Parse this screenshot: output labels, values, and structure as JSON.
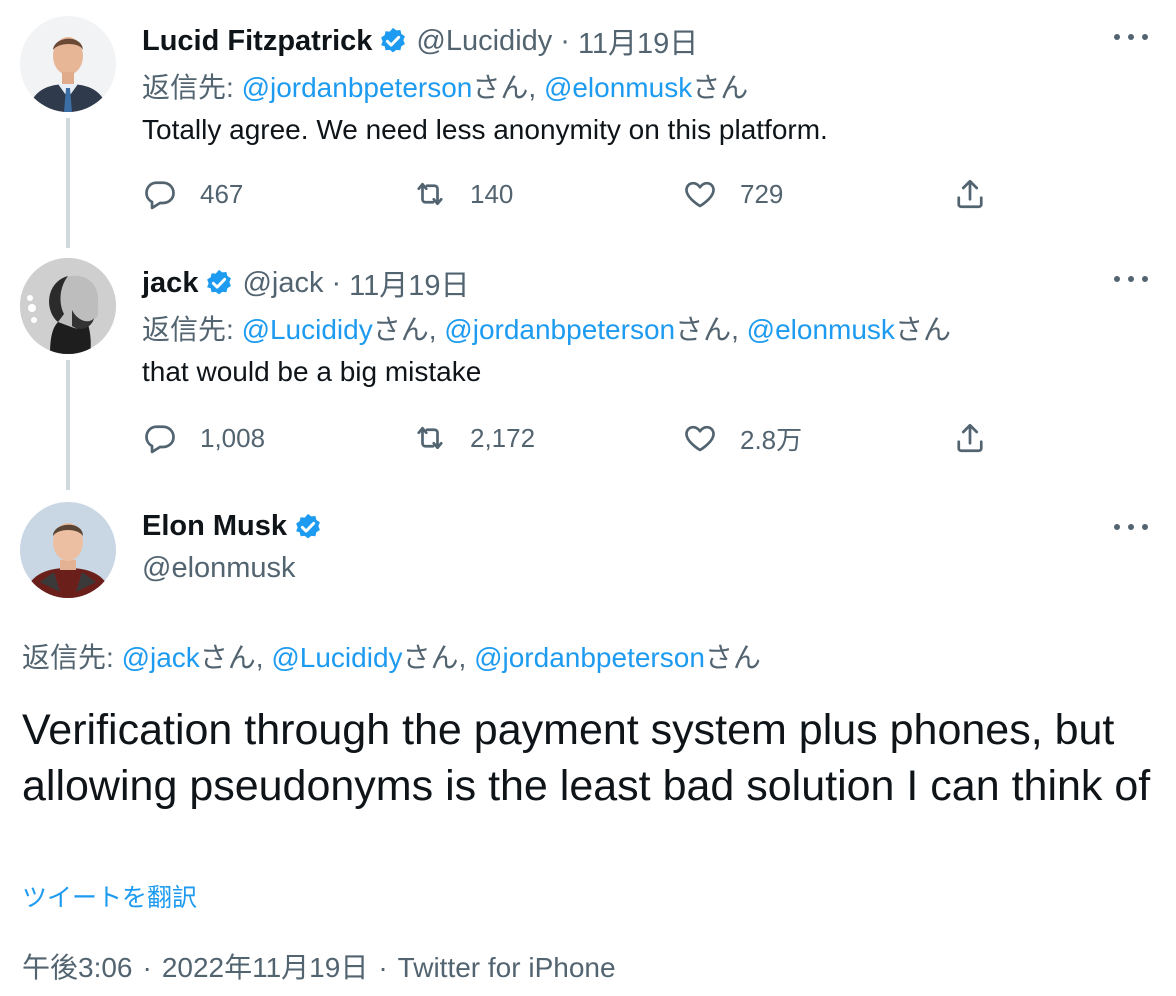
{
  "tweets": [
    {
      "name": "Lucid Fitzpatrick",
      "handle": "@Lucididy",
      "date": "11月19日",
      "reply_label": "返信先: ",
      "mentions": [
        "@jordanbpeterson",
        "@elonmusk"
      ],
      "mention_suffix": "さん",
      "mention_sep": ", ",
      "text": "Totally agree. We need less anonymity on this platform.",
      "replies": "467",
      "retweets": "140",
      "likes": "729"
    },
    {
      "name": "jack",
      "handle": "@jack",
      "date": "11月19日",
      "reply_label": "返信先: ",
      "mentions": [
        "@Lucididy",
        "@jordanbpeterson",
        "@elonmusk"
      ],
      "mention_suffix": "さん",
      "mention_sep": ", ",
      "text": "that would be a big mistake",
      "replies": "1,008",
      "retweets": "2,172",
      "likes": "2.8万"
    }
  ],
  "main": {
    "name": "Elon Musk",
    "handle": "@elonmusk",
    "reply_label": "返信先: ",
    "mentions": [
      "@jack",
      "@Lucididy",
      "@jordanbpeterson"
    ],
    "mention_suffix": "さん",
    "mention_sep": ", ",
    "text": "Verification through the payment system plus phones, but allowing pseudonyms is the least bad solution I can think of",
    "translate": "ツイートを翻訳",
    "time": "午後3:06",
    "date": "2022年11月19日",
    "source": "Twitter for iPhone"
  },
  "dot_sep": "·",
  "colors": {
    "accent": "#1d9bf0",
    "secondary_text": "#536471",
    "thread_line": "#cfd9de"
  },
  "icons": [
    "verified-badge-icon",
    "reply-icon",
    "retweet-icon",
    "like-icon",
    "share-icon",
    "more-icon"
  ]
}
